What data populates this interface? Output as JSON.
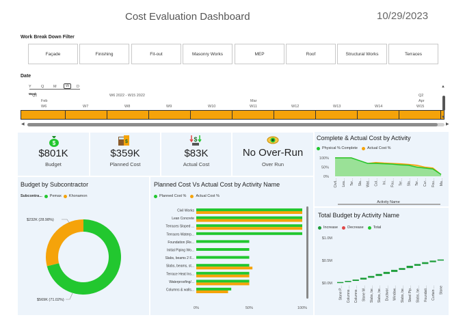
{
  "header": {
    "title": "Cost Evaluation Dashboard",
    "date": "10/29/2023"
  },
  "filter": {
    "label": "Work Break Down Filter",
    "buttons": [
      "Façade",
      "Finishing",
      "Fit-out",
      "Masonry Works",
      "MEP",
      "Roof",
      "Structural Works",
      "Terraces"
    ]
  },
  "date_slicer": {
    "label": "Date",
    "granularity": [
      "Y",
      "Q",
      "M",
      "W",
      "D"
    ],
    "active_granularity_label": "Week",
    "range_text": "W6 2022 - W15 2022",
    "quarter_left": "Q1",
    "month_left": "Feb",
    "month_mid": "Mar",
    "quarter_right": "Q2",
    "month_right": "Apr",
    "weeks": [
      "W6",
      "W7",
      "W8",
      "W9",
      "W10",
      "W11",
      "W12",
      "W13",
      "W14",
      "W15"
    ]
  },
  "kpis": [
    {
      "value": "$801K",
      "label": "Budget",
      "icon": "money-bag-icon"
    },
    {
      "value": "$359K",
      "label": "Planned Cost",
      "icon": "calculator-icon"
    },
    {
      "value": "$83K",
      "label": "Actual Cost",
      "icon": "dollar-arrows-icon"
    },
    {
      "value": "No Over-Run",
      "label": "Over Run",
      "icon": "eye-icon"
    }
  ],
  "colors": {
    "green": "#22c72f",
    "orange": "#f5a30a",
    "red": "#e04848",
    "card_bg": "#edf4fb"
  },
  "budget_subcontractor": {
    "title": "Budget by Subcontractor",
    "legend_label": "Subcontra...",
    "chart_data": {
      "type": "pie",
      "series": [
        {
          "name": "Pemax",
          "value": 569,
          "label": "$569K (71.02%)"
        },
        {
          "name": "Khonamon",
          "value": 232,
          "label": "$232K (28.98%)"
        }
      ]
    }
  },
  "planned_vs_actual": {
    "title": "Planned Cost Vs Actual Cost by Activity Name",
    "chart_data": {
      "type": "bar",
      "categories": [
        "Civil Works",
        "Lean Concrete",
        "Terraces Sloped ...",
        "Terraces Waterp...",
        "Foundation (Re...",
        "Initial Piping Wo...",
        "Slabs, beams 2 F...",
        "Slabs, beams, st...",
        "Terrace Heat Ins...",
        "Waterproofing/...",
        "Columns & walls..."
      ],
      "series": [
        {
          "name": "Planned Cost %",
          "values": [
            100,
            100,
            100,
            100,
            50,
            50,
            50,
            50,
            50,
            50,
            33
          ]
        },
        {
          "name": "Actual Cost %",
          "values": [
            100,
            100,
            100,
            0,
            0,
            0,
            0,
            53,
            50,
            50,
            30
          ]
        }
      ],
      "xticks": [
        "0%",
        "50%",
        "100%"
      ]
    }
  },
  "complete_actual": {
    "title": "Complete & Actual Cost by Activity",
    "xlabel": "Activity Name",
    "chart_data": {
      "type": "area",
      "categories": [
        "Civil...",
        "Lea...",
        "Ter...",
        "Sla...",
        "Wat...",
        "Col...",
        "Ini...",
        "Fou...",
        "Ter...",
        "Sla...",
        "Ter...",
        "Cur...",
        "Fou...",
        "Ma..."
      ],
      "series": [
        {
          "name": "Physical % Complete",
          "values": [
            100,
            100,
            100,
            85,
            70,
            70,
            68,
            66,
            62,
            60,
            50,
            45,
            40,
            10
          ]
        },
        {
          "name": "Actual Cost %",
          "values": [
            100,
            100,
            100,
            85,
            70,
            75,
            72,
            70,
            68,
            65,
            60,
            50,
            45,
            10
          ]
        }
      ],
      "yticks": [
        "100%",
        "50%",
        "0%"
      ]
    }
  },
  "total_budget": {
    "title": "Total Budget by Activity Name",
    "chart_data": {
      "type": "bar",
      "categories": [
        "Stone P...",
        "Columns ...",
        "Columns ...",
        "Stone W...",
        "Slabs, be...",
        "Slabs, be...",
        "Ductwor...",
        "Window...",
        "Slabs, be...",
        "Steel Pip...",
        "Slabs, be...",
        "Foundati...",
        "Curtain ...",
        "Stone"
      ],
      "series": [
        {
          "name": "Increase",
          "values": [
            20,
            25,
            30,
            40,
            40,
            45,
            45,
            45,
            40,
            50,
            40,
            40,
            35,
            25
          ]
        },
        {
          "name": "Decrease",
          "values": []
        },
        {
          "name": "Total",
          "values": []
        }
      ],
      "yticks": [
        "$1.0M",
        "$0.5M",
        "$0.0M"
      ]
    }
  }
}
